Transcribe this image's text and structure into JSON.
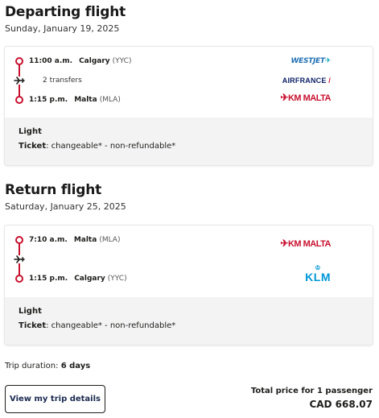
{
  "departing": {
    "title": "Departing flight",
    "date": "Sunday, January 19, 2025",
    "depart_time": "11:00 a.m.",
    "depart_city": "Calgary",
    "depart_code": "(YYC)",
    "stops": "2 transfers",
    "arrive_time": "1:15 p.m.",
    "arrive_city": "Malta",
    "arrive_code": "(MLA)",
    "airlines": [
      "WESTJET",
      "AIRFRANCE",
      "KM MALTA"
    ],
    "fare_name": "Light",
    "ticket_label": "Ticket",
    "ticket_value": ": changeable* - non-refundable*"
  },
  "return": {
    "title": "Return flight",
    "date": "Saturday, January 25, 2025",
    "depart_time": "7:10 a.m.",
    "depart_city": "Malta",
    "depart_code": "(MLA)",
    "arrive_time": "1:15 p.m.",
    "arrive_city": "Calgary",
    "arrive_code": "(YYC)",
    "airlines": [
      "KM MALTA",
      "KLM"
    ],
    "fare_name": "Light",
    "ticket_label": "Ticket",
    "ticket_value": ": changeable* - non-refundable*"
  },
  "summary": {
    "duration_label": "Trip duration: ",
    "duration_value": "6 days",
    "details_button": "View my trip details",
    "price_label": "Total price for 1 passenger",
    "price_value": "CAD 668.07"
  },
  "colors": {
    "accent": "#c8102e",
    "fare_bg": "#f3f3f3",
    "westjet": "#1f6fb5",
    "klm": "#0097d7"
  }
}
